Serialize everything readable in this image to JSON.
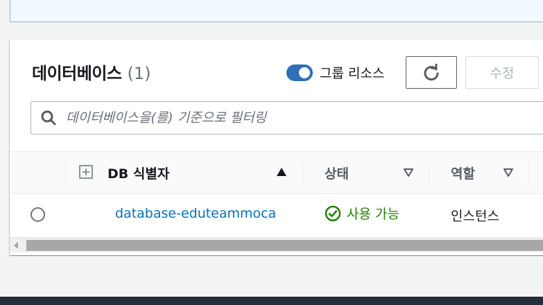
{
  "header": {
    "title": "데이터베이스",
    "count": "(1)",
    "group_toggle_label": "그룹 리소스",
    "group_toggle_on": true,
    "refresh_icon": "refresh-icon",
    "edit_label": "수정"
  },
  "filter": {
    "placeholder": "데이터베이스을(를) 기준으로 필터링",
    "value": ""
  },
  "table": {
    "columns": [
      {
        "label": "DB 식별자",
        "sort": "ascending"
      },
      {
        "label": "상태",
        "sort": "none"
      },
      {
        "label": "역할",
        "sort": "none"
      }
    ],
    "rows": [
      {
        "db_identifier": "database-eduteammoca",
        "status": "사용 가능",
        "role": "인스턴스",
        "selected": false
      }
    ]
  },
  "colors": {
    "accent": "#2e6fb5",
    "link": "#0073bb",
    "status_available": "#1d8102",
    "footer": "#232f3e"
  }
}
